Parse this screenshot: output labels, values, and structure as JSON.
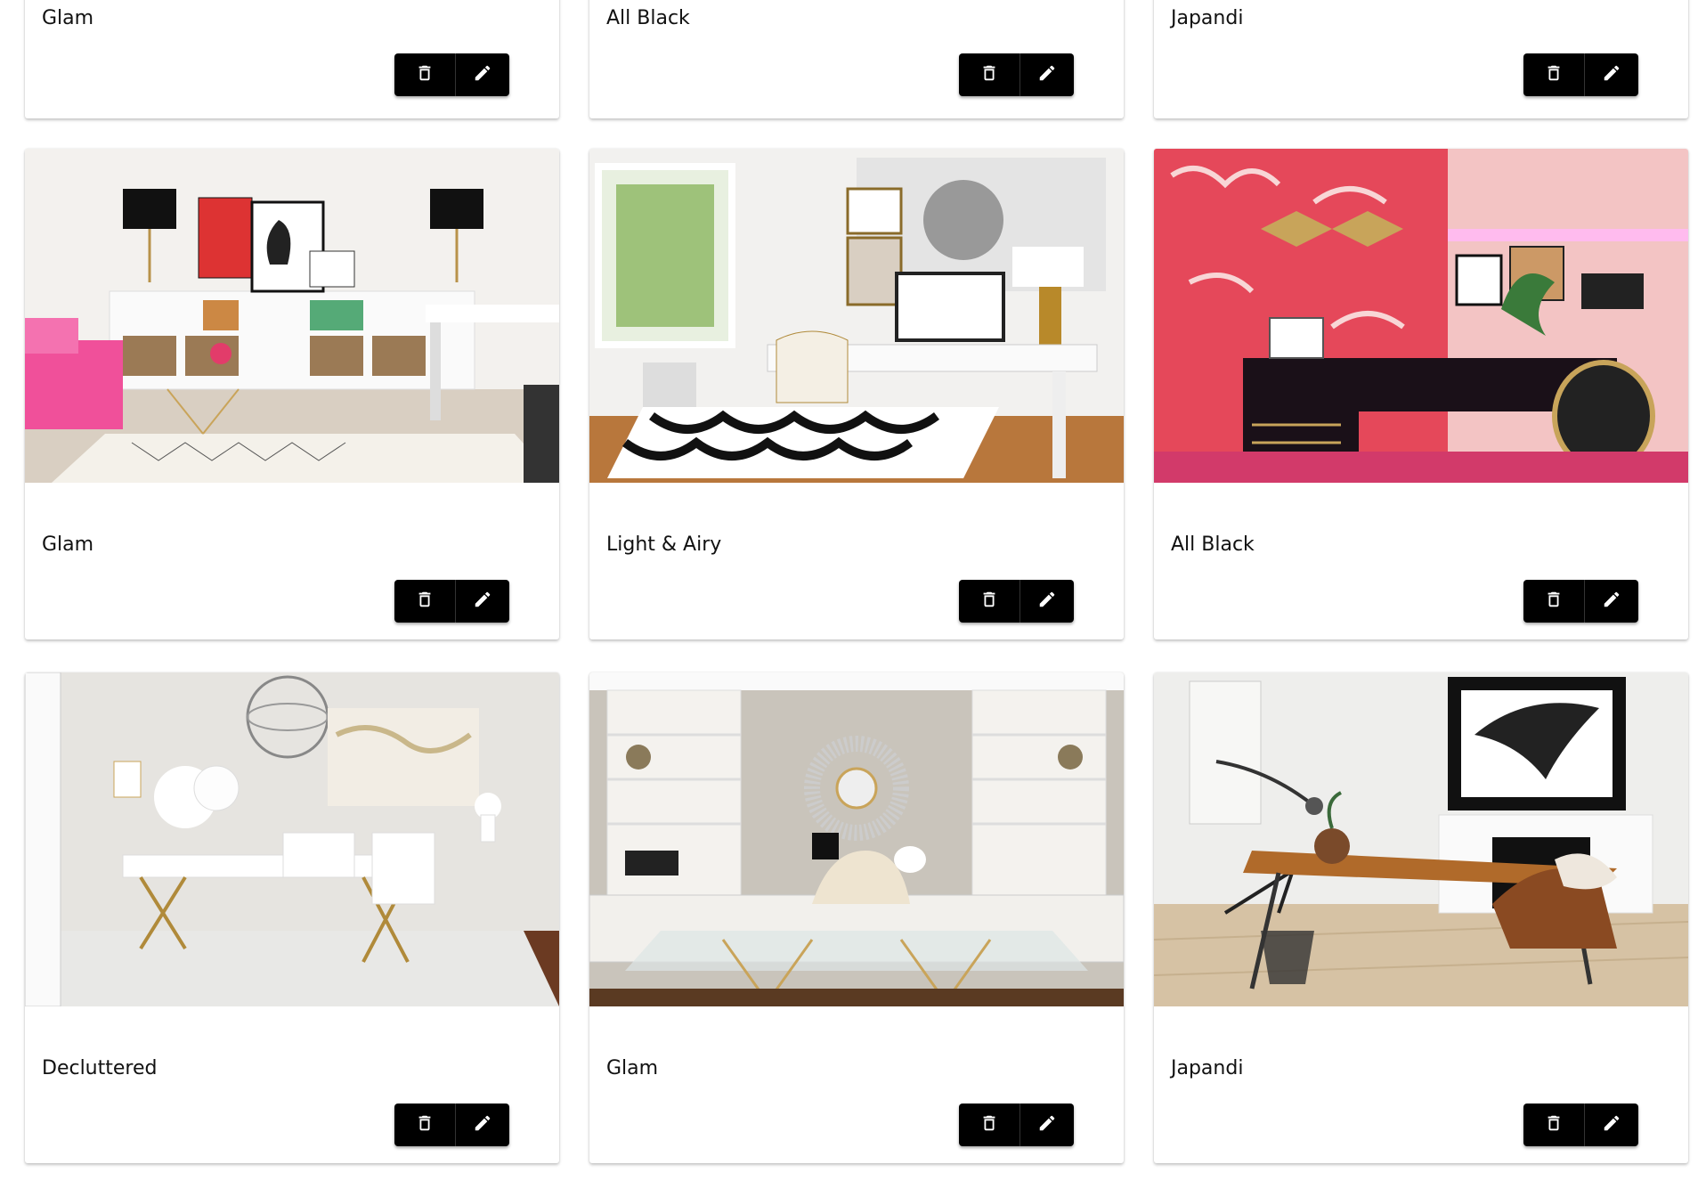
{
  "colors": {
    "button_bg": "#000000",
    "card_bg": "#ffffff",
    "text": "#111111"
  },
  "cards": [
    {
      "title": "Glam",
      "image": "glam-office-pink-sofa"
    },
    {
      "title": "All Black",
      "image": ""
    },
    {
      "title": "Japandi",
      "image": ""
    },
    {
      "title": "Glam",
      "image": "glam-office-pink-sofa"
    },
    {
      "title": "Light & Airy",
      "image": "white-desk-zebra-rug"
    },
    {
      "title": "All Black",
      "image": "pink-wallpaper-black-desk"
    },
    {
      "title": "Decluttered",
      "image": "white-desk-gold-legs-chandelier"
    },
    {
      "title": "Glam",
      "image": "glass-desk-built-in-shelves"
    },
    {
      "title": "Japandi",
      "image": "wood-desk-abstract-art"
    }
  ],
  "buttons": {
    "delete_icon": "trash-icon",
    "edit_icon": "pencil-icon"
  }
}
